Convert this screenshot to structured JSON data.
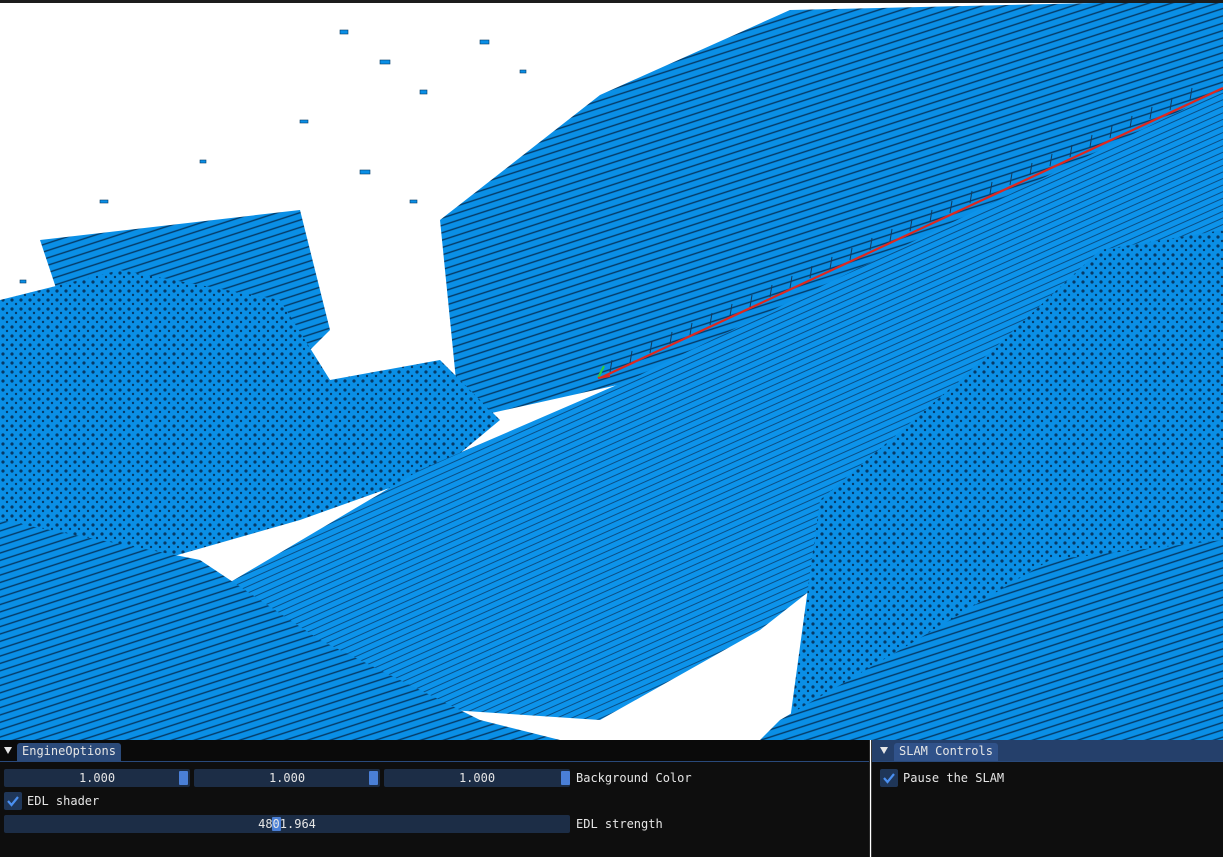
{
  "viewport": {
    "description_icon": "point-cloud-3d-view",
    "point_color": "#0a8fe6",
    "background_color": "#ffffff",
    "trajectory_color": "#e0281e"
  },
  "engine_options": {
    "title": "EngineOptions",
    "background_color_label": "Background Color",
    "background_rgb": [
      "1.000",
      "1.000",
      "1.000"
    ],
    "edl_shader_label": "EDL shader",
    "edl_shader_checked": true,
    "edl_strength_label": "EDL strength",
    "edl_strength_value": "4801.964"
  },
  "slam_controls": {
    "title": "SLAM Controls",
    "pause_label": "Pause the SLAM",
    "pause_checked": true
  }
}
